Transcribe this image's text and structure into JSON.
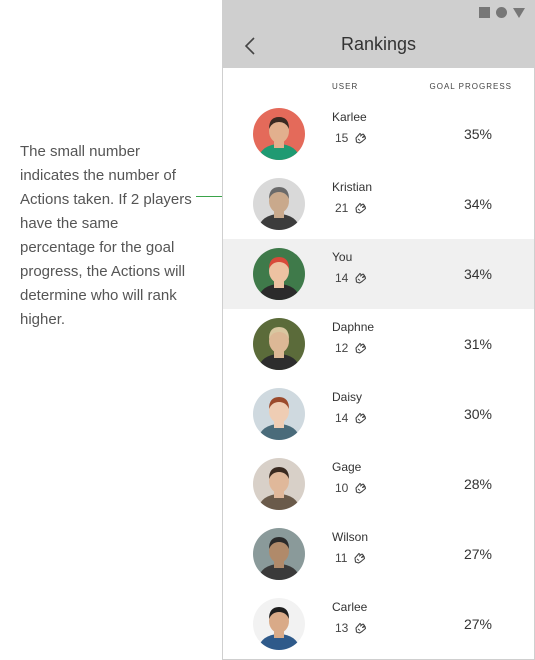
{
  "annotation": {
    "text": "The small number indicates the number of Actions taken. If 2 players have the same percentage for the goal progress, the Actions will determine who will rank higher."
  },
  "header": {
    "title": "Rankings"
  },
  "columns": {
    "user": "USER",
    "goal_progress": "GOAL PROGRESS"
  },
  "icons": {
    "back": "chevron-left-icon",
    "actions": "hand-icon"
  },
  "colors": {
    "annotation_line": "#3aa34a",
    "header_bg": "#cfcfcf",
    "highlight_row": "#f0f0f0"
  },
  "rankings": [
    {
      "name": "Karlee",
      "actions": "15",
      "progress": "35%"
    },
    {
      "name": "Kristian",
      "actions": "21",
      "progress": "34%"
    },
    {
      "name": "You",
      "actions": "14",
      "progress": "34%"
    },
    {
      "name": "Daphne",
      "actions": "12",
      "progress": "31%"
    },
    {
      "name": "Daisy",
      "actions": "14",
      "progress": "30%"
    },
    {
      "name": "Gage",
      "actions": "10",
      "progress": "28%"
    },
    {
      "name": "Wilson",
      "actions": "11",
      "progress": "27%"
    },
    {
      "name": "Carlee",
      "actions": "13",
      "progress": "27%"
    }
  ]
}
